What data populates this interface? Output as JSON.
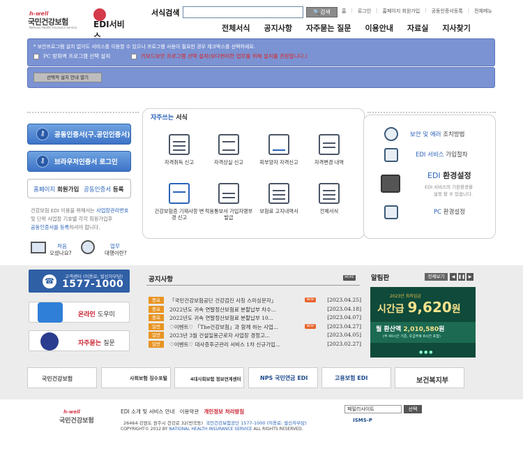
{
  "header": {
    "logo": {
      "hwell": "h-well",
      "name": "국민건강보험",
      "sub": "National Health Insurance Service",
      "service": "EDI서비스"
    },
    "search": {
      "label": "서식검색",
      "button": "검색",
      "value": ""
    },
    "toplinks": [
      "홈",
      "로그인",
      "홈페이지 회원가입",
      "공동인증서등록",
      "전체메뉴"
    ],
    "gnb": [
      "전체서식",
      "공지사항",
      "자주묻는 질문",
      "이용안내",
      "자료실",
      "지사찾기"
    ]
  },
  "notice": {
    "text": "* 보안프로그램 설치 없이도 서비스를 이용할 수 있으나 프로그램 사용이 필요한 경우 체크박스를 선택하세요.",
    "option1": "PC 방화벽 프로그램 선택 설치",
    "option2": "키보드보안 프로그램 선택 설치(보다편리한 업무를 위해 설치를 권장합니다.)",
    "install_button": "선택적 설치 안내 열기"
  },
  "left": {
    "btn_cert": "공동인증서(구.공인인증서)",
    "btn_browser": "브라우저인증서 로그인",
    "tab_join_a": "홈페이지",
    "tab_join_b": "회원가입",
    "tab_reg_a": "공동인증서",
    "tab_reg_b": "등록",
    "desc1": "건강보험 EDI 이용을 위해서는 ",
    "desc1b": "사업장관리번호",
    "desc2": "및 단위 사업장 기호별 각각 회원가입후",
    "desc3a": "공동인증서를 등록",
    "desc3b": "하셔야 합니다.",
    "first_a": "처음",
    "first_b": "오셨나요?",
    "biz_a": "업무",
    "biz_b": "대행이란?"
  },
  "favorites": {
    "title_a": "자주쓰는",
    "title_b": "서식",
    "items": [
      "자격취득 신고",
      "자격상실 신고",
      "피부양자 자격신고",
      "자격변경 내역",
      "건강보험증 기재사항 변경 신고",
      "적용통보서 가입자명부 발급",
      "보험료 고지내역서",
      "전체서식"
    ]
  },
  "right": {
    "r1a": "보안 및 에러",
    "r1b": "조치방법",
    "r2a": "EDI 서비스",
    "r2b": "가입절차",
    "r3a": "EDI",
    "r3b": "환경설정",
    "r3c": "EDI 서비스의 기본환경을",
    "r3d": "설정 할 수 있습니다.",
    "r4a": "PC",
    "r4b": "환경설정"
  },
  "support": {
    "call_label": "고객센터 (이용료: 발신자부담)",
    "call_number": "1577-1000",
    "online_a": "온라인",
    "online_b": "도우미",
    "faq_a": "자주묻는",
    "faq_b": "질문"
  },
  "notices": {
    "title": "공지사항",
    "more": "MORE",
    "rows": [
      {
        "badge": "중요",
        "text": "「국민건강보험공단 건강검진 사칭 스미싱문자」",
        "new": true,
        "date": "[2023.04.25]"
      },
      {
        "badge": "중요",
        "text": "2022년도 귀속 연말정산보험료 분할납부 차수...",
        "new": false,
        "date": "[2023.04.18]"
      },
      {
        "badge": "중요",
        "text": "2022년도 귀속 연말정산보험료 분할납부 10...",
        "new": false,
        "date": "[2023.04.07]"
      },
      {
        "badge": "일반",
        "text": "♡이벤트♡ 「The건강보험」과 함께 하는 사업...",
        "new": true,
        "date": "[2023.04.27]"
      },
      {
        "badge": "일반",
        "text": "2023년 3월 건설일용근로자 사업장 경정고...",
        "new": false,
        "date": "[2023.04.05]"
      },
      {
        "badge": "일반",
        "text": "♡이벤트♡ 대사증후군관리 서비스 1차 신규가입...",
        "new": false,
        "date": "[2023.02.27]"
      }
    ]
  },
  "bulletin": {
    "title": "알림판",
    "view_all": "전체보기",
    "banner_year": "2023년 최저임금",
    "banner_a": "시간급",
    "banner_amt": "9,620",
    "banner_unit": "원",
    "banner_b": "월 환산액",
    "banner_b_amt": "2,010,580",
    "banner_b_unit": "원",
    "banner_c": "(주 40시간 기준, 유급주휴 8시간 포함)"
  },
  "partners": [
    "국민건강보험",
    "사회보험 징수포털",
    "4대사회보험 정보연계센터",
    "NPS 국민연금 EDI",
    "고용보험 EDI",
    "보건복지부"
  ],
  "footer": {
    "links_a": "EDI 소개 및 서비스 안내",
    "links_b": "이용약관",
    "links_c": "개인정보 처리방침",
    "addr_a": "26464 강원도 원주시 건강로 32(반곡동)",
    "addr_b": "국민건강보험공단 1577-1000 (이용료: 발신자부담)",
    "copy_a": "COPYRIGHT© 2012 BY ",
    "copy_b": "NATIONAL HEALTH INSURANCE SERVICE",
    "copy_c": " ALL RIGHTS RESERVED.",
    "family": "패밀리사이트",
    "family_btn": "선택",
    "isms": "ISMS-P"
  }
}
